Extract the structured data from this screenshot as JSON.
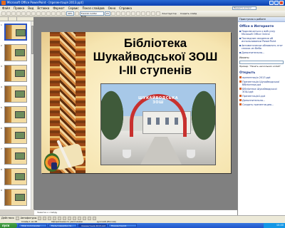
{
  "window": {
    "title": "Microsoft Office PowerPoint - [презентація 2013.ppt]"
  },
  "menu": [
    "Файл",
    "Правка",
    "Вид",
    "Вставка",
    "Формат",
    "Сервис",
    "Показ слайдов",
    "Окно",
    "Справка"
  ],
  "help_placeholder": "Введите вопрос",
  "toolbar": {
    "zoom": "49%",
    "font": "Franklin Gothic Book",
    "size": "18",
    "designer": "Конструктор",
    "new_slide": "Создать слайд"
  },
  "slide": {
    "title_lines": [
      "Бібліотека",
      "Шукайводської ЗОШ",
      "І-ІІІ ступенів"
    ],
    "arch_text": "ШУКАЙВОДСЬКА ЗОШ"
  },
  "thumbs": [
    "1",
    "2",
    "3",
    "4",
    "5",
    "6",
    "7",
    "8",
    "9",
    "10"
  ],
  "notes_placeholder": "Заметки к слайду",
  "taskpane": {
    "header": "Приступая к работе",
    "section1": "Office в Интернете",
    "links": [
      "Подключиться к веб-узлу Microsoft Office Online",
      "Последние сведения об использовании PowerPoint",
      "Автоматически обновлять этот список из Веба",
      "Дополнительно..."
    ],
    "search_label": "Искать:",
    "search_example": "Пример: \"Печать нескольких копий\"",
    "section2": "Открыть",
    "files": [
      "презентація 2013.ppt",
      "Презентація Шукайводської бібліотеки.ppt",
      "Бібліотека Шукайводської ЗОШ.ppt",
      "Презентація1.ppt"
    ],
    "more": "Дополнительно...",
    "create": "Создать презентацию..."
  },
  "drawbar": {
    "actions": "Действия",
    "autoshapes": "Автофигуры"
  },
  "status": {
    "slide": "Слайд 1 из 28",
    "design": "Оформление по умолчанию",
    "lang": "русский (Россия)"
  },
  "taskbar": {
    "start": "пуск",
    "tasks": [
      "Total Commander",
      "Мультимедійні пр...",
      "презентація 2013.ppt",
      "Презентація1"
    ],
    "clock": "10:40"
  }
}
